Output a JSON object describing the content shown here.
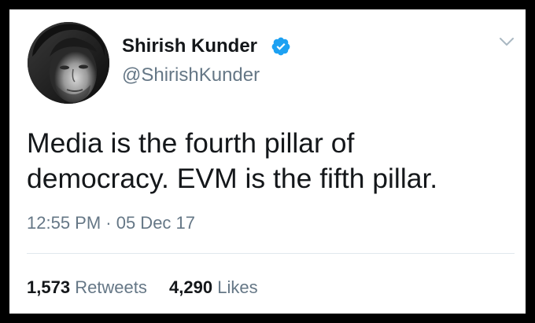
{
  "author": {
    "display_name": "Shirish Kunder",
    "handle": "@ShirishKunder",
    "verified": true
  },
  "tweet": {
    "text_lines": [
      "Media is the fourth pillar of",
      "democracy. EVM is the fifth pillar."
    ],
    "timestamp": "12:55 PM · 05 Dec 17"
  },
  "stats": {
    "retweets_count": "1,573",
    "retweets_label": "Retweets",
    "likes_count": "4,290",
    "likes_label": "Likes"
  },
  "icons": {
    "verified": "verified-badge-icon",
    "menu": "chevron-down-icon"
  },
  "colors": {
    "frame": "#000000",
    "card": "#ffffff",
    "text": "#14171a",
    "secondary": "#657786",
    "verified": "#1da1f2",
    "divider": "#e1e8ed"
  }
}
